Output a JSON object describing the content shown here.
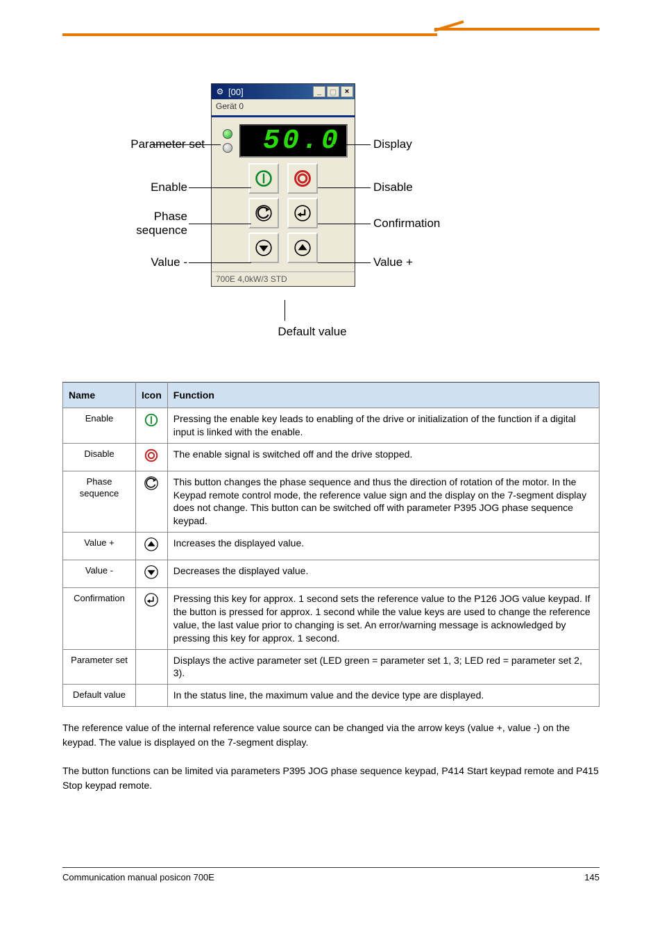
{
  "window": {
    "title": "[00]",
    "subtitle": "Gerät 0",
    "display_value": "50.0",
    "status_text": "700E 4,0kW/3 STD"
  },
  "labels": {
    "parameter_set": "Parameter set",
    "enable": "Enable",
    "phase_sequence_1": "Phase",
    "phase_sequence_2": "sequence",
    "value_minus": "Value -",
    "display": "Display",
    "disable": "Disable",
    "confirmation": "Confirmation",
    "value_plus": "Value +",
    "default_value": "Default value"
  },
  "table": {
    "headers": {
      "name": "Name",
      "icon": "Icon",
      "function": "Function"
    },
    "rows": [
      {
        "name": "Enable",
        "icon": "enable",
        "func": "Pressing the enable key leads to enabling of the drive or initialization of the function if a digital input is linked with the enable."
      },
      {
        "name": "Disable",
        "icon": "disable",
        "func": "The enable signal is switched off and the drive stopped."
      },
      {
        "name": "Phase sequence",
        "icon": "phase",
        "func": "This button changes the phase sequence and thus the direction of rotation of the motor. In the Keypad remote control mode, the reference value sign and the display on the 7-segment display does not change. This button can be switched off with parameter P395 JOG phase sequence keypad."
      },
      {
        "name": "Value +",
        "icon": "up",
        "func": "Increases the displayed value."
      },
      {
        "name": "Value -",
        "icon": "down",
        "func": "Decreases the displayed value."
      },
      {
        "name": "Confirmation",
        "icon": "enter",
        "func": "Pressing this key for approx. 1 second sets the reference value to the P126 JOG value keypad. If the button is pressed for approx. 1 second while the value keys are used to change the reference value, the last value prior to changing is set. An error/warning message is acknowledged by pressing this key for approx. 1 second."
      },
      {
        "name": "Parameter set",
        "icon": "",
        "func": "Displays the active parameter set (LED green = parameter set 1, 3; LED red = parameter set 2, 3)."
      },
      {
        "name": "Default value",
        "icon": "",
        "func": "In the status line, the maximum value and the device type are displayed."
      }
    ]
  },
  "paragraph": {
    "p1": "The reference value of the internal reference value source can be changed via the arrow keys (value +, value -) on the keypad. The value is displayed on the 7-segment display.",
    "p2": "The button functions can be limited via parameters P395 JOG phase sequence keypad, P414 Start keypad remote and P415 Stop keypad remote."
  },
  "footer": {
    "left": "Communication manual posicon 700E",
    "right": "145"
  }
}
